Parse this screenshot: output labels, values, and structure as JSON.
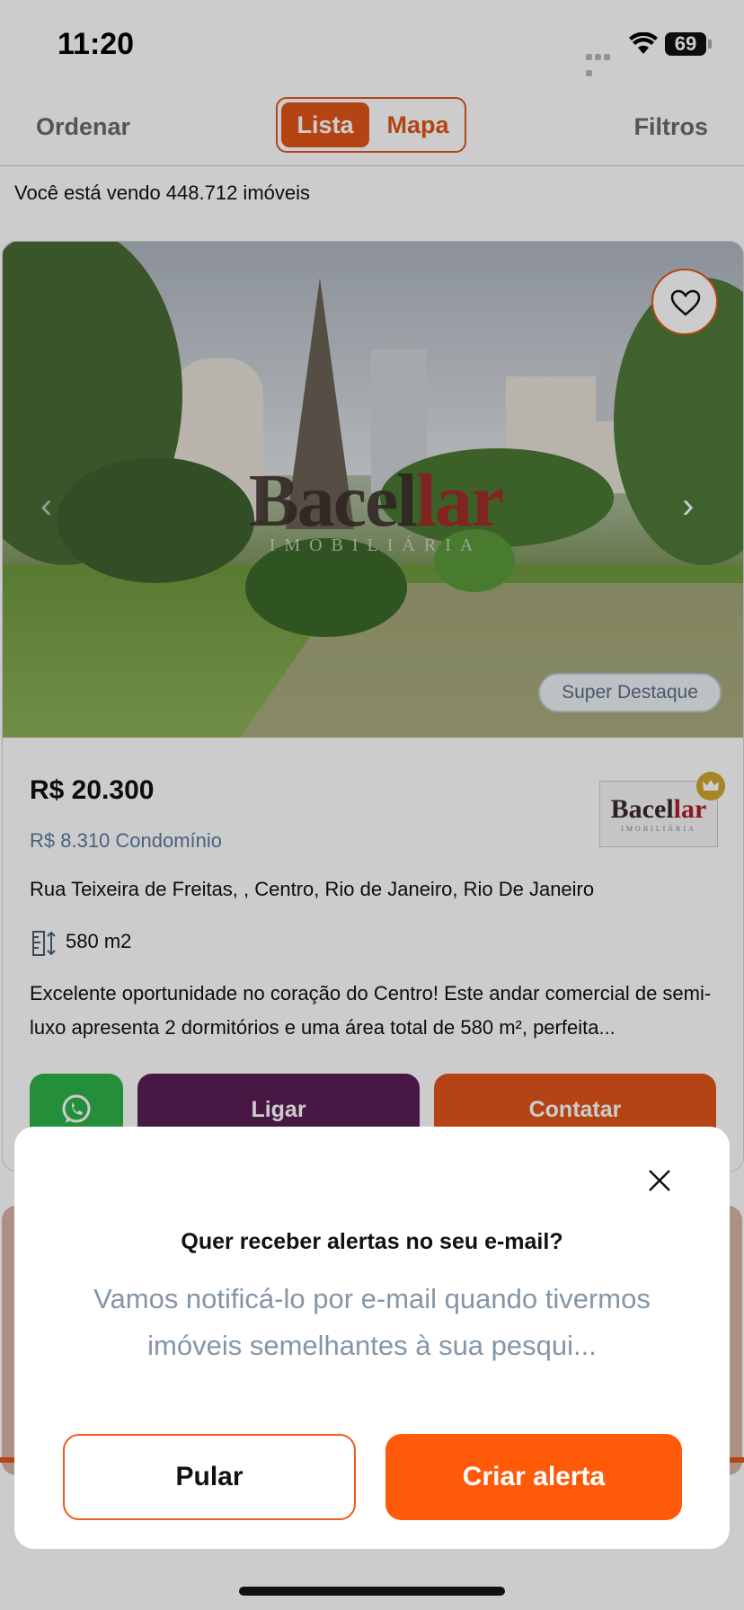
{
  "status_bar": {
    "time": "11:20",
    "battery": "69"
  },
  "topbar": {
    "sort_label": "Ordenar",
    "list_label": "Lista",
    "map_label": "Mapa",
    "filters_label": "Filtros"
  },
  "results": {
    "count_text": "Você está vendo 448.712 imóveis"
  },
  "listing": {
    "badge": "Super Destaque",
    "price": "R$ 20.300",
    "condo": "R$ 8.310 Condomínio",
    "address": "Rua Teixeira de Freitas, , Centro, Rio de Janeiro, Rio De Janeiro",
    "area": "580 m2",
    "description": "Excelente oportunidade no coração do Centro! Este andar comercial de semi-luxo apresenta 2 dormitórios e uma área total de 580 m², perfeita...",
    "call_label": "Ligar",
    "contact_label": "Contatar",
    "watermark_brand_a": "Bacel",
    "watermark_brand_b": "lar",
    "watermark_sub": "IMOBILIÁRIA",
    "logo_brand_a": "Bacel",
    "logo_brand_b": "lar",
    "logo_sub": "IMOBILIÁRIA"
  },
  "alert_modal": {
    "title": "Quer receber alertas no seu e-mail?",
    "message": "Vamos notificá-lo por e-mail quando tivermos imóveis semelhantes à sua pesqui...",
    "skip_label": "Pular",
    "create_label": "Criar alerta"
  },
  "colors": {
    "accent": "#e1561a",
    "call": "#5b1f57",
    "whatsapp": "#2fb24a",
    "cta": "#ff5a0a"
  }
}
